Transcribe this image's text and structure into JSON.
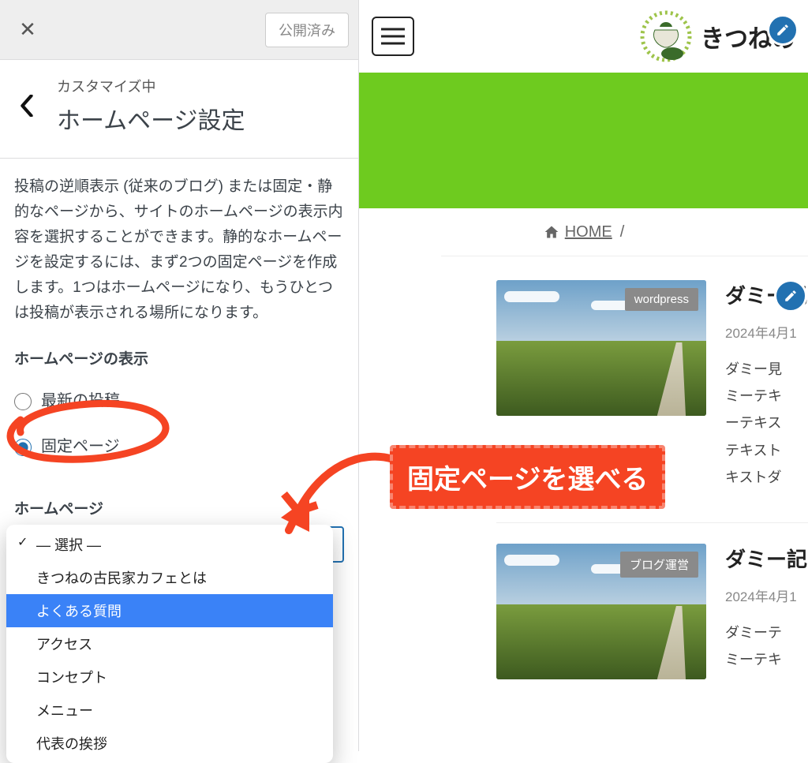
{
  "toolbar": {
    "close": "✕",
    "published": "公開済み"
  },
  "section": {
    "customizing": "カスタマイズ中",
    "title": "ホームページ設定",
    "description": "投稿の逆順表示 (従来のブログ) または固定・静的なページから、サイトのホームページの表示内容を選択することができます。静的なホームページを設定するには、まず2つの固定ページを作成します。1つはホームページになり、もうひとつは投稿が表示される場所になります。",
    "display_label": "ホームページの表示",
    "radio_latest": "最新の投稿",
    "radio_page": "固定ページ",
    "homepage_label": "ホームページ"
  },
  "dropdown": {
    "selected": "— 選択 —",
    "items": [
      "— 選択 —",
      "きつねの古民家カフェとは",
      "よくある質問",
      "アクセス",
      "コンセプト",
      "メニュー",
      "代表の挨拶"
    ],
    "highlight_index": 2,
    "checked_index": 0
  },
  "callout": "固定ページを選べる",
  "preview": {
    "site_title_fragment": "きつねの",
    "breadcrumb_home": "HOME",
    "breadcrumb_sep": "/",
    "posts": [
      {
        "tag": "wordpress",
        "title": "ダミー記",
        "date": "2024年4月1",
        "excerpt_lines": [
          "ダミー見",
          "ミーテキ",
          "ーテキス",
          "テキスト",
          "キストダ"
        ]
      },
      {
        "tag": "ブログ運営",
        "title": "ダミー記",
        "date": "2024年4月1",
        "excerpt_lines": [
          "ダミーテ",
          "ミーテキ"
        ]
      }
    ]
  }
}
